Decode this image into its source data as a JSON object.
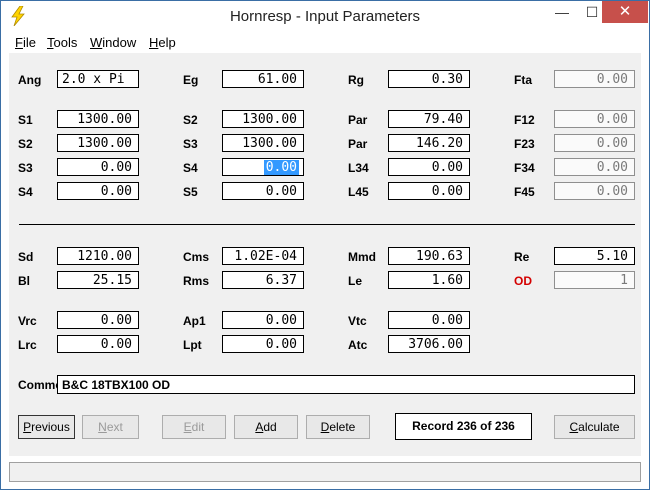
{
  "window": {
    "title": "Hornresp - Input Parameters",
    "minimize": "—",
    "maximize": "☐",
    "close": "✕"
  },
  "menu": [
    {
      "u": "F",
      "rest": "ile"
    },
    {
      "u": "T",
      "rest": "ools"
    },
    {
      "u": "W",
      "rest": "indow"
    },
    {
      "u": "H",
      "rest": "elp"
    }
  ],
  "params": {
    "ang": {
      "label": "Ang",
      "value": "2.0 x Pi"
    },
    "eg": {
      "label": "Eg",
      "value": "61.00"
    },
    "rg": {
      "label": "Rg",
      "value": "0.30"
    },
    "fta": {
      "label": "Fta",
      "value": "0.00"
    },
    "s1": {
      "label": "S1",
      "value": "1300.00"
    },
    "s2a": {
      "label": "S2",
      "value": "1300.00"
    },
    "par1": {
      "label": "Par",
      "value": "79.40"
    },
    "f12": {
      "label": "F12",
      "value": "0.00"
    },
    "s2b": {
      "label": "S2",
      "value": "1300.00"
    },
    "s3a": {
      "label": "S3",
      "value": "1300.00"
    },
    "par2": {
      "label": "Par",
      "value": "146.20"
    },
    "f23": {
      "label": "F23",
      "value": "0.00"
    },
    "s3b": {
      "label": "S3",
      "value": "0.00"
    },
    "s4a": {
      "label": "S4",
      "value": "0.00"
    },
    "l34": {
      "label": "L34",
      "value": "0.00"
    },
    "f34": {
      "label": "F34",
      "value": "0.00"
    },
    "s4b": {
      "label": "S4",
      "value": "0.00"
    },
    "s5": {
      "label": "S5",
      "value": "0.00"
    },
    "l45": {
      "label": "L45",
      "value": "0.00"
    },
    "f45": {
      "label": "F45",
      "value": "0.00"
    },
    "sd": {
      "label": "Sd",
      "value": "1210.00"
    },
    "cms": {
      "label": "Cms",
      "value": "1.02E-04"
    },
    "mmd": {
      "label": "Mmd",
      "value": "190.63"
    },
    "re": {
      "label": "Re",
      "value": "5.10"
    },
    "bl": {
      "label": "Bl",
      "value": "25.15"
    },
    "rms": {
      "label": "Rms",
      "value": "6.37"
    },
    "le": {
      "label": "Le",
      "value": "1.60"
    },
    "od": {
      "label": "OD",
      "value": "1"
    },
    "vrc": {
      "label": "Vrc",
      "value": "0.00"
    },
    "ap1": {
      "label": "Ap1",
      "value": "0.00"
    },
    "vtc": {
      "label": "Vtc",
      "value": "0.00"
    },
    "lrc": {
      "label": "Lrc",
      "value": "0.00"
    },
    "lpt": {
      "label": "Lpt",
      "value": "0.00"
    },
    "atc": {
      "label": "Atc",
      "value": "3706.00"
    }
  },
  "comment": {
    "label": "Comment",
    "value": "B&C 18TBX100 OD"
  },
  "buttons": {
    "previous": {
      "u": "P",
      "rest": "revious"
    },
    "next": {
      "u": "N",
      "rest": "ext"
    },
    "edit": {
      "u": "E",
      "rest": "dit"
    },
    "add": {
      "u": "A",
      "rest": "dd"
    },
    "delete": {
      "u": "D",
      "rest": "elete"
    },
    "calculate": {
      "u": "C",
      "rest": "alculate"
    }
  },
  "record": "Record 236 of 236",
  "colors": {
    "accent": "#3399ff",
    "close": "#c7504b",
    "od_label": "#d40000"
  }
}
